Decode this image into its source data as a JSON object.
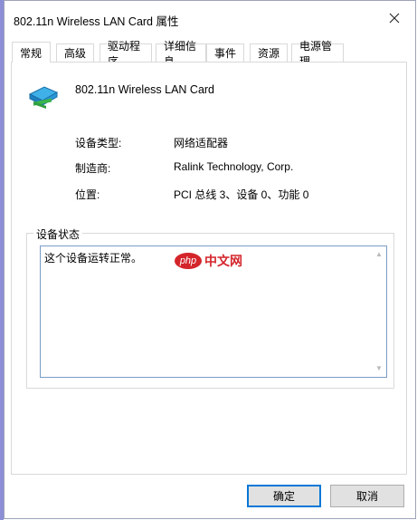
{
  "window": {
    "title": "802.11n Wireless LAN Card 属性"
  },
  "tabs": [
    {
      "label": "常规"
    },
    {
      "label": "高级"
    },
    {
      "label": "驱动程序"
    },
    {
      "label": "详细信息"
    },
    {
      "label": "事件"
    },
    {
      "label": "资源"
    },
    {
      "label": "电源管理"
    }
  ],
  "device": {
    "name": "802.11n Wireless LAN Card",
    "icon": "network-adapter-icon"
  },
  "properties": [
    {
      "label": "设备类型:",
      "value": "网络适配器"
    },
    {
      "label": "制造商:",
      "value": "Ralink Technology, Corp."
    },
    {
      "label": "位置:",
      "value": "PCI 总线 3、设备 0、功能 0"
    }
  ],
  "status": {
    "group_title": "设备状态",
    "text": "这个设备运转正常。",
    "watermark": {
      "badge": "php",
      "text": "中文网"
    }
  },
  "buttons": {
    "ok": "确定",
    "cancel": "取消"
  },
  "colors": {
    "default_button_border": "#0078d7",
    "watermark": "#d4252b"
  }
}
